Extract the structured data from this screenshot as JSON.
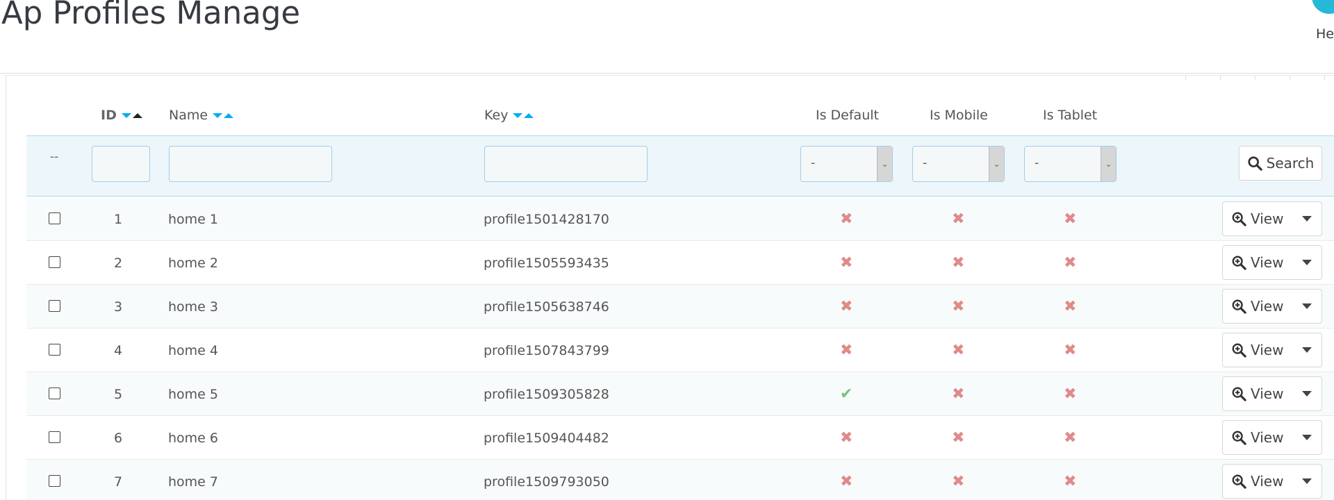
{
  "header": {
    "title": "Ap Profiles Manage",
    "help_label": "He"
  },
  "table": {
    "columns": {
      "id": "ID",
      "name": "Name",
      "key": "Key",
      "is_default": "Is Default",
      "is_mobile": "Is Mobile",
      "is_tablet": "Is Tablet"
    },
    "filters": {
      "bulk_placeholder": "--",
      "id_value": "",
      "name_value": "",
      "key_value": "",
      "is_default_selected": "-",
      "is_mobile_selected": "-",
      "is_tablet_selected": "-",
      "search_label": "Search"
    },
    "view_label": "View",
    "rows": [
      {
        "id": "1",
        "name": "home 1",
        "key": "profile1501428170",
        "is_default": "no",
        "is_mobile": "no",
        "is_tablet": "no"
      },
      {
        "id": "2",
        "name": "home 2",
        "key": "profile1505593435",
        "is_default": "no",
        "is_mobile": "no",
        "is_tablet": "no"
      },
      {
        "id": "3",
        "name": "home 3",
        "key": "profile1505638746",
        "is_default": "no",
        "is_mobile": "no",
        "is_tablet": "no"
      },
      {
        "id": "4",
        "name": "home 4",
        "key": "profile1507843799",
        "is_default": "no",
        "is_mobile": "no",
        "is_tablet": "no"
      },
      {
        "id": "5",
        "name": "home 5",
        "key": "profile1509305828",
        "is_default": "yes",
        "is_mobile": "no",
        "is_tablet": "no"
      },
      {
        "id": "6",
        "name": "home 6",
        "key": "profile1509404482",
        "is_default": "no",
        "is_mobile": "no",
        "is_tablet": "no"
      },
      {
        "id": "7",
        "name": "home 7",
        "key": "profile1509793050",
        "is_default": "no",
        "is_mobile": "no",
        "is_tablet": "no"
      }
    ]
  },
  "colors": {
    "accent": "#00aff0",
    "cross": "#e08a8a",
    "check": "#72c279",
    "filter_bg": "#edf6fb"
  },
  "icons": {
    "yes": "check-icon",
    "no": "cross-icon",
    "search": "search-icon",
    "view": "zoom-in-icon"
  }
}
